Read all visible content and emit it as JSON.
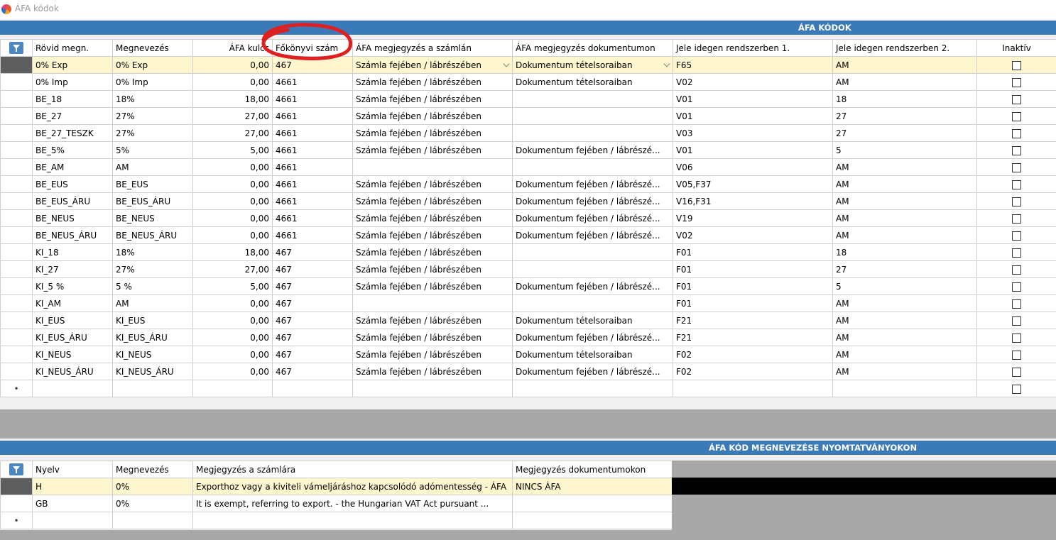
{
  "window": {
    "title": "ÁFA kódok"
  },
  "top_panel": {
    "title": "ÁFA KÓDOK",
    "columns": [
      "Rövid megn.",
      "Megnevezés",
      "ÁFA kulcs",
      "Főkönyvi szám",
      "ÁFA megjegyzés a számlán",
      "ÁFA megjegyzés dokumentumon",
      "Jele idegen rendszerben 1.",
      "Jele idegen rendszerben 2.",
      "Inaktív"
    ],
    "rows": [
      [
        "0% Exp",
        "0% Exp",
        "0,00",
        "467",
        "Számla fejében / lábrészében",
        "Dokumentum tételsoraiban",
        "F65",
        "AM"
      ],
      [
        "0% Imp",
        "0% Imp",
        "0,00",
        "4661",
        "Számla fejében / lábrészében",
        "Dokumentum tételsoraiban",
        "V02",
        "AM"
      ],
      [
        "BE_18",
        "18%",
        "18,00",
        "4661",
        "Számla fejében / lábrészében",
        "",
        "V01",
        "18"
      ],
      [
        "BE_27",
        "27%",
        "27,00",
        "4661",
        "Számla fejében / lábrészében",
        "",
        "V01",
        "27"
      ],
      [
        "BE_27_TESZK",
        "27%",
        "27,00",
        "4661",
        "Számla fejében / lábrészében",
        "",
        "V03",
        "27"
      ],
      [
        "BE_5%",
        "5%",
        "5,00",
        "4661",
        "Számla fejében / lábrészében",
        "Dokumentum fejében / lábrészé...",
        "V01",
        "5"
      ],
      [
        "BE_AM",
        "AM",
        "0,00",
        "4661",
        "",
        "",
        "V06",
        "AM"
      ],
      [
        "BE_EUS",
        "BE_EUS",
        "0,00",
        "4661",
        "Számla fejében / lábrészében",
        "Dokumentum fejében / lábrészé...",
        "V05,F37",
        "AM"
      ],
      [
        "BE_EUS_ÁRU",
        "BE_EUS_ÁRU",
        "0,00",
        "4661",
        "Számla fejében / lábrészében",
        "Dokumentum fejében / lábrészé...",
        "V16,F31",
        "AM"
      ],
      [
        "BE_NEUS",
        "BE_NEUS",
        "0,00",
        "4661",
        "Számla fejében / lábrészében",
        "Dokumentum fejében / lábrészé...",
        "V19",
        "AM"
      ],
      [
        "BE_NEUS_ÁRU",
        "BE_NEUS_ÁRU",
        "0,00",
        "4661",
        "Számla fejében / lábrészében",
        "Dokumentum fejében / lábrészé...",
        "V02",
        "AM"
      ],
      [
        "KI_18",
        "18%",
        "18,00",
        "467",
        "Számla fejében / lábrészében",
        "",
        "F01",
        "18"
      ],
      [
        "KI_27",
        "27%",
        "27,00",
        "467",
        "Számla fejében / lábrészében",
        "",
        "F01",
        "27"
      ],
      [
        "KI_5 %",
        "5 %",
        "5,00",
        "467",
        "Számla fejében / lábrészében",
        "Dokumentum fejében / lábrészé...",
        "F01",
        "5"
      ],
      [
        "KI_AM",
        "AM",
        "0,00",
        "467",
        "",
        "",
        "F01",
        "AM"
      ],
      [
        "KI_EUS",
        "KI_EUS",
        "0,00",
        "467",
        "Számla fejében / lábrészében",
        "Dokumentum tételsoraiban",
        "F21",
        "AM"
      ],
      [
        "KI_EUS_ÁRU",
        "KI_EUS_ÁRU",
        "0,00",
        "467",
        "Számla fejében / lábrészében",
        "Dokumentum fejében / lábrészé...",
        "F21",
        "AM"
      ],
      [
        "KI_NEUS",
        "KI_NEUS",
        "0,00",
        "467",
        "Számla fejében / lábrészében",
        "Dokumentum tételsoraiban",
        "F02",
        "AM"
      ],
      [
        "KI_NEUS_ÁRU",
        "KI_NEUS_ÁRU",
        "0,00",
        "467",
        "Számla fejében / lábrészében",
        "Dokumentum fejében / lábrészé...",
        "F02",
        "AM"
      ]
    ],
    "new_row_marker": "*"
  },
  "bottom_panel": {
    "title": "ÁFA KÓD MEGNEVEZÉSE NYOMTATVÁNYOKON",
    "columns": [
      "Nyelv",
      "Megnevezés",
      "Megjegyzés a számlára",
      "Megjegyzés dokumentumokon"
    ],
    "rows": [
      [
        "H",
        "0%",
        "Exportho​z vagy a kiviteli vámeljáráshoz kapcsolódó adómentesség -  ÁFA",
        "NINCS ÁFA"
      ],
      [
        "GB",
        "0%",
        "It is exempt, referring to export. - the Hungarian VAT Act pursuant ...",
        ""
      ]
    ],
    "new_row_marker": "*"
  },
  "colors": {
    "header_blue": "#3b7ab9",
    "active_row": "#fdf6cf",
    "annotation_red": "#e02020"
  },
  "icons": {
    "app": "app-logo-icon",
    "filter": "filter-icon",
    "dropdown": "chevron-down-icon"
  }
}
